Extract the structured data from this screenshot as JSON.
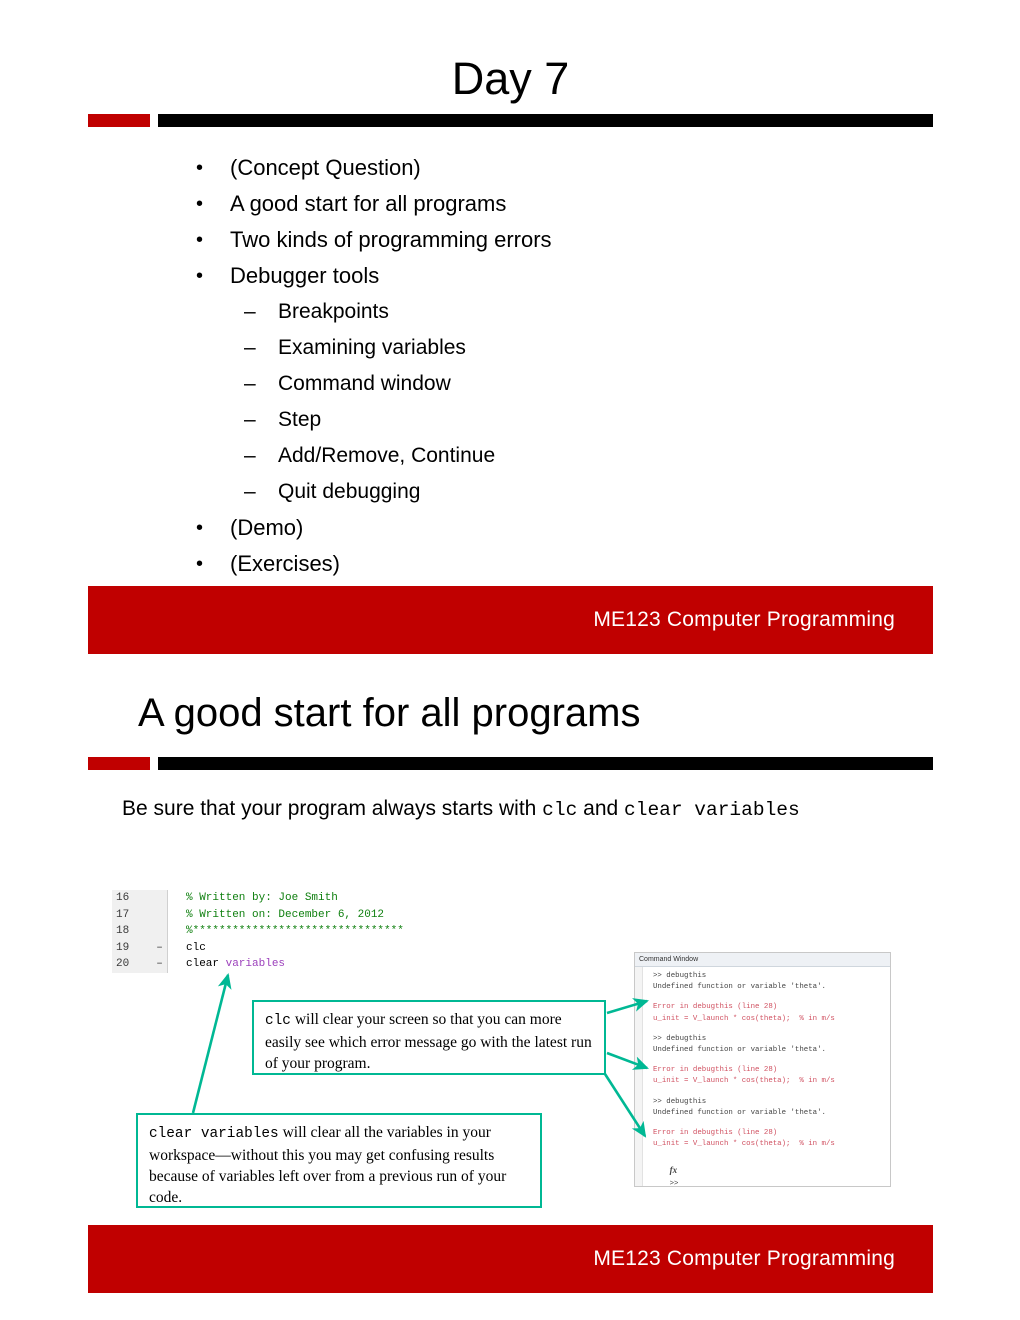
{
  "deck": {
    "accent_red": "#C00000",
    "accent_black": "#000000",
    "callout_border": "#00B894"
  },
  "slide1": {
    "title": "Day 7",
    "bullets": [
      {
        "level": 1,
        "mark": "•",
        "text": "(Concept Question)"
      },
      {
        "level": 1,
        "mark": "•",
        "text": "A good start for all programs"
      },
      {
        "level": 1,
        "mark": "•",
        "text": "Two kinds of programming errors"
      },
      {
        "level": 1,
        "mark": "•",
        "text": "Debugger tools"
      },
      {
        "level": 2,
        "mark": "–",
        "text": "Breakpoints"
      },
      {
        "level": 2,
        "mark": "–",
        "text": "Examining variables"
      },
      {
        "level": 2,
        "mark": "–",
        "text": "Command window"
      },
      {
        "level": 2,
        "mark": "–",
        "text": "Step"
      },
      {
        "level": 2,
        "mark": "–",
        "text": "Add/Remove, Continue"
      },
      {
        "level": 2,
        "mark": "–",
        "text": "Quit debugging"
      },
      {
        "level": 1,
        "mark": "•",
        "text": "(Demo)"
      },
      {
        "level": 1,
        "mark": "•",
        "text": "(Exercises)"
      }
    ],
    "footer": "ME123 Computer Programming"
  },
  "slide2": {
    "title": "A good start for all programs",
    "body": {
      "part1": "Be sure that your program always starts with ",
      "code1": "clc",
      "part2": " and ",
      "code2": "clear variables"
    },
    "code_block": {
      "lines": [
        {
          "num": "16",
          "bp": "",
          "segments": [
            {
              "style": "cm",
              "text": "% Written by: Joe Smith"
            }
          ]
        },
        {
          "num": "17",
          "bp": "",
          "segments": [
            {
              "style": "cm",
              "text": "% Written on: December 6, 2012"
            }
          ]
        },
        {
          "num": "18",
          "bp": "",
          "segments": [
            {
              "style": "cm",
              "text": "%********************************"
            }
          ]
        },
        {
          "num": "19",
          "bp": "–",
          "segments": [
            {
              "style": "",
              "text": "clc"
            }
          ]
        },
        {
          "num": "20",
          "bp": "–",
          "segments": [
            {
              "style": "",
              "text": "clear "
            },
            {
              "style": "kw",
              "text": "variables"
            }
          ]
        }
      ]
    },
    "callouts": [
      {
        "id": "clc",
        "code": "clc",
        "text": " will clear your screen so that you can more easily see which error message go with the latest run of your program."
      },
      {
        "id": "clear",
        "code": "clear variables",
        "text": " will clear all the variables in your workspace—without this you may get confusing results because of variables left over from a previous run of your code."
      }
    ],
    "command_window": {
      "title": "Command Window",
      "lines": [
        {
          "kind": "normal",
          "text": ">> debugthis"
        },
        {
          "kind": "normal",
          "text": "Undefined function or variable 'theta'."
        },
        {
          "kind": "blank",
          "text": ""
        },
        {
          "kind": "error",
          "text": "Error in debugthis (line 28)"
        },
        {
          "kind": "error",
          "text": "u_init = V_launch * cos(theta);  % in m/s"
        },
        {
          "kind": "blank",
          "text": ""
        },
        {
          "kind": "normal",
          "text": ">> debugthis"
        },
        {
          "kind": "normal",
          "text": "Undefined function or variable 'theta'."
        },
        {
          "kind": "blank",
          "text": ""
        },
        {
          "kind": "error",
          "text": "Error in debugthis (line 28)"
        },
        {
          "kind": "error",
          "text": "u_init = V_launch * cos(theta);  % in m/s"
        },
        {
          "kind": "blank",
          "text": ""
        },
        {
          "kind": "normal",
          "text": ">> debugthis"
        },
        {
          "kind": "normal",
          "text": "Undefined function or variable 'theta'."
        },
        {
          "kind": "blank",
          "text": ""
        },
        {
          "kind": "error",
          "text": "Error in debugthis (line 28)"
        },
        {
          "kind": "error",
          "text": "u_init = V_launch * cos(theta);  % in m/s"
        }
      ],
      "prompt_fx": "fx",
      "prompt": ">>"
    },
    "footer": "ME123 Computer Programming"
  }
}
